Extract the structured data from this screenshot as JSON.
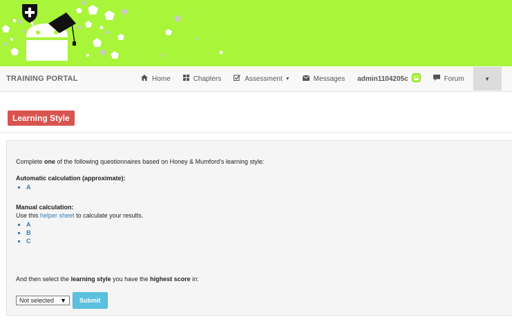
{
  "banner": {
    "bg_color": "#a8f53a",
    "logo_icon": "android-graduate-with-cross-badge"
  },
  "navbar": {
    "brand": "TRAINING PORTAL",
    "items": [
      {
        "label": "Home",
        "icon": "home-icon"
      },
      {
        "label": "Chapters",
        "icon": "grid-icon"
      },
      {
        "label": "Assessment",
        "icon": "check-square-icon",
        "has_caret": true
      },
      {
        "label": "Messages",
        "icon": "envelope-icon"
      },
      {
        "label": "admin1104205c",
        "icon": "avatar-icon"
      },
      {
        "label": "Forum",
        "icon": "comment-icon"
      }
    ]
  },
  "page": {
    "title": "Learning Style",
    "title_color": "#d9534f"
  },
  "content": {
    "intro_prefix": "Complete ",
    "intro_bold": "one",
    "intro_suffix": " of the following questionnaires based on Honey & Mumford's learning style:",
    "auto_heading": "Automatic calculation (approximate):",
    "auto_links": [
      "A"
    ],
    "manual_heading": "Manual calculation:",
    "use_prefix": "Use this ",
    "use_link": "helper sheet",
    "use_suffix": " to calculate your results.",
    "manual_links": [
      "A",
      "B",
      "C"
    ],
    "select_prefix": "And then select the ",
    "select_bold1": "learning style",
    "select_middle": " you have the ",
    "select_bold2": "highest score",
    "select_suffix": " in:",
    "dropdown_value": "Not selected",
    "submit_label": "Submit",
    "accent_color": "#5bc0de"
  }
}
